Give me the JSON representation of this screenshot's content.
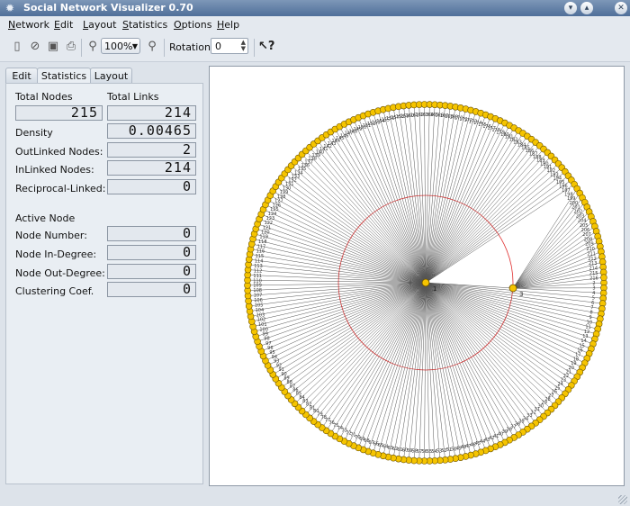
{
  "window": {
    "title": "Social Network Visualizer 0.70",
    "app_icon": "gear-icon"
  },
  "menu": [
    "Network",
    "Edit",
    "Layout",
    "Statistics",
    "Options",
    "Help"
  ],
  "toolbar": {
    "icons": [
      "new-file-icon",
      "open-folder-icon",
      "save-icon",
      "print-icon",
      "zoom-in-icon",
      "zoom-out-icon",
      "whats-this-icon"
    ],
    "zoom_value": "100%",
    "rotation_label": "Rotation:",
    "rotation_value": "0"
  },
  "tabs": [
    {
      "label": "Edit",
      "active": false
    },
    {
      "label": "Statistics",
      "active": true
    },
    {
      "label": "Layout",
      "active": false
    }
  ],
  "stats": {
    "total_nodes_label": "Total Nodes",
    "total_nodes": "215",
    "total_links_label": "Total Links",
    "total_links": "214",
    "density_label": "Density",
    "density": "0.00465",
    "outlinked_label": "OutLinked Nodes:",
    "outlinked": "2",
    "inlinked_label": "InLinked Nodes:",
    "inlinked": "214",
    "reciprocal_label": "Reciprocal-Linked:",
    "reciprocal": "0"
  },
  "active_node": {
    "heading": "Active Node",
    "number_label": "Node Number:",
    "number": "0",
    "in_degree_label": "Node In-Degree:",
    "in_degree": "0",
    "out_degree_label": "Node Out-Degree:",
    "out_degree": "0",
    "clustering_label": "Clustering Coef.",
    "clustering": "0"
  },
  "graph": {
    "node_count": 215,
    "hub_node": "1",
    "second_hub": "3",
    "node_color": "#f5c400",
    "edge_color": "#555555",
    "guide_circle_color": "#e03030"
  }
}
